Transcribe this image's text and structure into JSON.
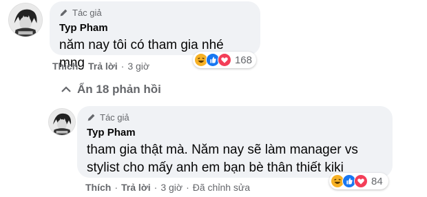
{
  "comment1": {
    "author_badge": "Tác giả",
    "name": "Typ Pham",
    "text": "năm nay tôi có tham gia nhé mng",
    "actions": {
      "like": "Thích",
      "reply": "Trả lời",
      "time": "3 giờ"
    },
    "reactions": {
      "icons": [
        "haha-icon",
        "like-icon",
        "love-icon"
      ],
      "count": "168"
    }
  },
  "toggle": {
    "label": "Ẩn 18 phản hồi",
    "icon": "chevron-up-icon"
  },
  "comment2": {
    "author_badge": "Tác giả",
    "name": "Typ Pham",
    "text_line1": "tham gia thật mà. Năm nay sẽ làm manager vs",
    "text_line2": "stylist cho mấy anh em bạn bè thân thiết kiki",
    "actions": {
      "like": "Thích",
      "reply": "Trả lời",
      "time": "3 giờ",
      "edited": "Đã chỉnh sửa"
    },
    "reactions": {
      "icons": [
        "haha-icon",
        "like-icon",
        "love-icon"
      ],
      "count": "84"
    }
  },
  "colors": {
    "bubble": "#f0f2f5",
    "like": "#1877f2",
    "love": "#f33e58",
    "haha": "#f7b125",
    "muted": "#65676b"
  }
}
